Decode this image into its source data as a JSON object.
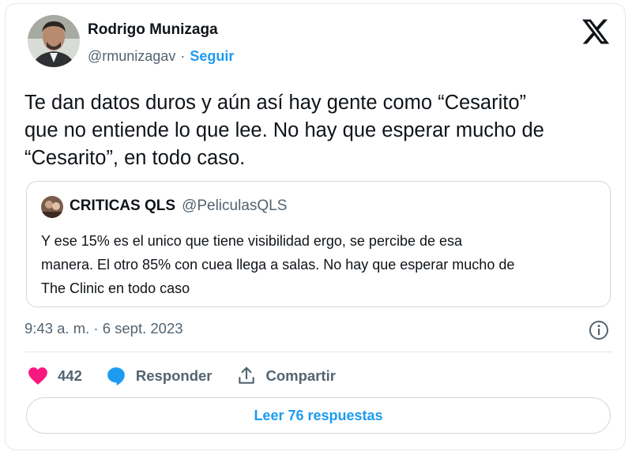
{
  "author": {
    "name": "Rodrigo Munizaga",
    "handle": "@rmunizagav",
    "separator": "·",
    "follow_label": "Seguir"
  },
  "tweet": {
    "text": "Te dan datos duros y aún así hay gente como “Cesarito”\nque no entiende lo que lee. No hay que esperar mucho de\n“Cesarito”, en todo caso."
  },
  "quoted_tweet": {
    "name": "CRITICAS QLS",
    "handle": "@PeliculasQLS",
    "text": "Y ese 15% es el unico que tiene visibilidad ergo, se percibe de esa\nmanera. El otro 85% con cuea llega a salas. No hay que esperar mucho de\nThe Clinic en todo caso"
  },
  "timestamp": "9:43 a. m. · 6 sept. 2023",
  "actions": {
    "like_count": "442",
    "reply_label": "Responder",
    "share_label": "Compartir"
  },
  "replies_button_label": "Leer 76 respuestas",
  "colors": {
    "accent": "#1d9bf0",
    "like": "#f91880",
    "text_primary": "#0f1419",
    "text_secondary": "#536471",
    "border": "#cfd9de"
  },
  "icons": [
    "x-logo-icon",
    "info-icon",
    "heart-icon",
    "reply-bubble-icon",
    "share-icon"
  ]
}
